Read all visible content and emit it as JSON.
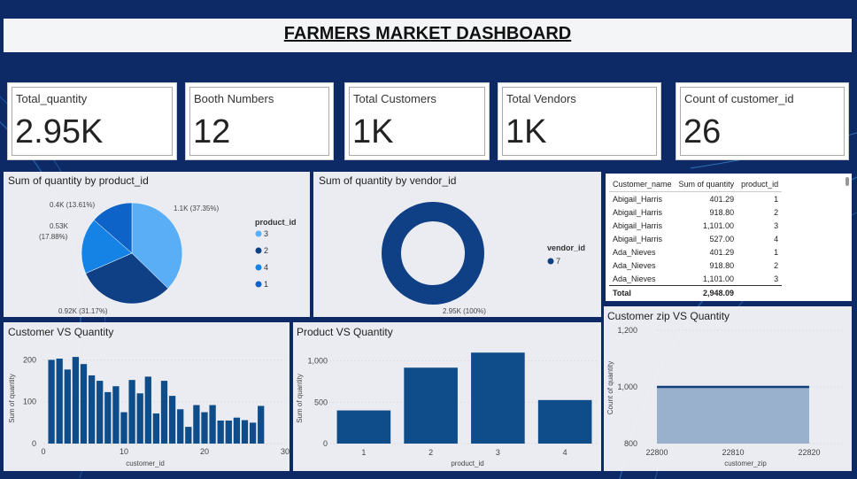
{
  "header": {
    "title": "FARMERS MARKET DASHBOARD"
  },
  "cards": [
    {
      "label": "Total_quantity",
      "value": "2.95K"
    },
    {
      "label": "Booth Numbers",
      "value": "12"
    },
    {
      "label": "Total Customers",
      "value": "1K"
    },
    {
      "label": "Total Vendors",
      "value": "1K"
    },
    {
      "label": "Count of customer_id",
      "value": "26"
    }
  ],
  "colors": {
    "background": "#0e2a66",
    "bar": "#0f4c8a",
    "pie": [
      "#5aaef5",
      "#0f3f85",
      "#1583e6",
      "#0d63c7"
    ],
    "line": "#133f7a",
    "area": "#9ab1cd"
  },
  "table": {
    "headers": [
      "Customer_name",
      "Sum of quantity",
      "product_id"
    ],
    "rows": [
      [
        "Abigail_Harris",
        "401.29",
        "1"
      ],
      [
        "Abigail_Harris",
        "918.80",
        "2"
      ],
      [
        "Abigail_Harris",
        "1,101.00",
        "3"
      ],
      [
        "Abigail_Harris",
        "527.00",
        "4"
      ],
      [
        "Ada_Nieves",
        "401.29",
        "1"
      ],
      [
        "Ada_Nieves",
        "918.80",
        "2"
      ],
      [
        "Ada_Nieves",
        "1,101.00",
        "3"
      ]
    ],
    "total_label": "Total",
    "total_value": "2,948.09"
  },
  "chart_data": [
    {
      "type": "pie",
      "title": "Sum of quantity by product_id",
      "legend_title": "product_id",
      "legend_placement": "right",
      "slices": [
        {
          "label": "3",
          "value": 1.1,
          "pct": 37.35,
          "text": "1.1K (37.35%)"
        },
        {
          "label": "2",
          "value": 0.92,
          "pct": 31.17,
          "text": "0.92K (31.17%)"
        },
        {
          "label": "4",
          "value": 0.53,
          "pct": 17.88,
          "text_line1": "0.53K",
          "text_line2": "(17.88%)"
        },
        {
          "label": "1",
          "value": 0.4,
          "pct": 13.61,
          "text": "0.4K (13.61%)"
        }
      ]
    },
    {
      "type": "pie",
      "title": "Sum of quantity by vendor_id",
      "legend_title": "vendor_id",
      "legend_placement": "right",
      "slices": [
        {
          "label": "7",
          "value": 2.95,
          "pct": 100,
          "text": "2.95K (100%)"
        }
      ]
    },
    {
      "type": "bar",
      "title": "Customer VS Quantity",
      "xlabel": "customer_id",
      "ylabel": "Sum of quantity",
      "xlim": [
        0,
        30
      ],
      "ylim": [
        0,
        220
      ],
      "xticks": [
        "0",
        "10",
        "20",
        "30"
      ],
      "yticks": [
        "0",
        "100",
        "200"
      ],
      "x": [
        1,
        2,
        3,
        4,
        5,
        6,
        7,
        8,
        9,
        10,
        11,
        12,
        13,
        14,
        15,
        16,
        17,
        18,
        19,
        20,
        21,
        22,
        23,
        24,
        25,
        26,
        27
      ],
      "values": [
        200,
        203,
        177,
        207,
        190,
        163,
        150,
        123,
        137,
        75,
        152,
        120,
        160,
        72,
        150,
        114,
        82,
        40,
        92,
        75,
        92,
        55,
        55,
        62,
        56,
        50,
        90
      ]
    },
    {
      "type": "bar",
      "title": "Product VS Quantity",
      "xlabel": "product_id",
      "ylabel": "Sum of quantity",
      "ylim": [
        0,
        1200
      ],
      "yticks": [
        "0",
        "500",
        "1,000"
      ],
      "categories": [
        "1",
        "2",
        "3",
        "4"
      ],
      "values": [
        401.29,
        918.8,
        1101.0,
        527.0
      ]
    },
    {
      "type": "area",
      "title": "Customer zip VS Quantity",
      "xlabel": "customer_zip",
      "ylabel": "Count of quantity",
      "xlim": [
        22800,
        22820
      ],
      "ylim": [
        800,
        1200
      ],
      "xticks": [
        "22800",
        "22810",
        "22820"
      ],
      "yticks": [
        "800",
        "1,000",
        "1,200"
      ],
      "x": [
        22800,
        22820
      ],
      "y": [
        1000,
        1000
      ]
    }
  ]
}
